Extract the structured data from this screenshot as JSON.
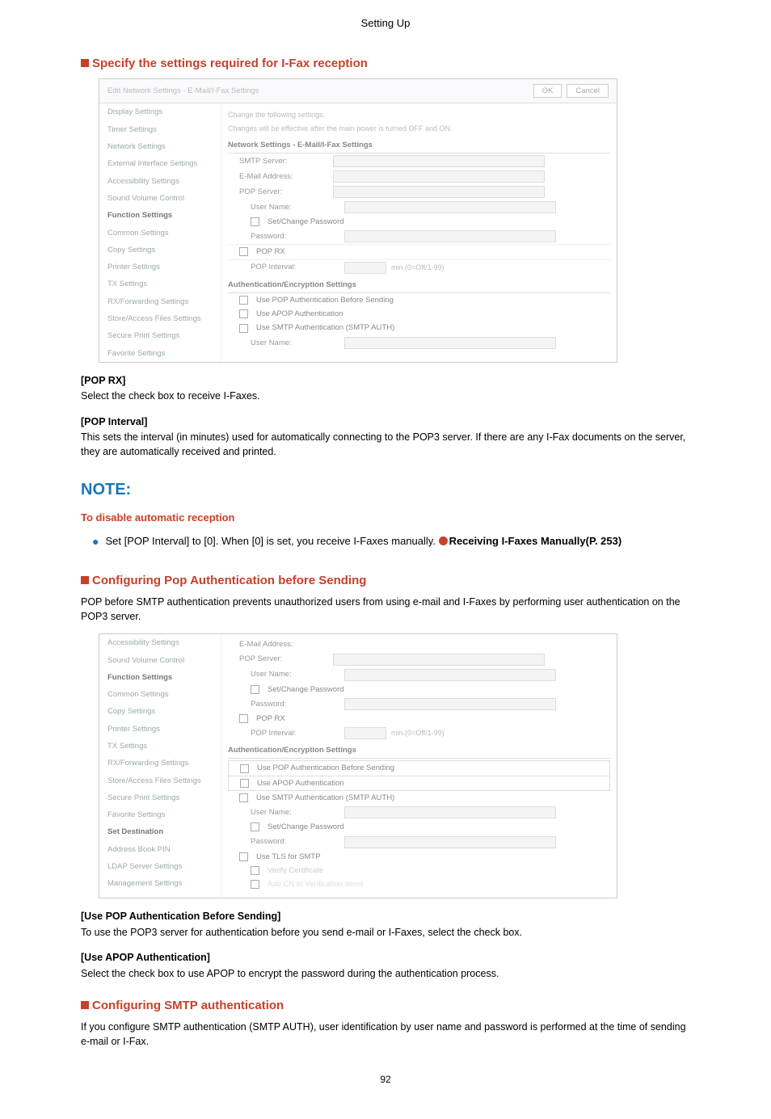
{
  "page_header": "Setting Up",
  "page_number": "92",
  "section1": {
    "title": "Specify the settings required for I-Fax reception",
    "pop_rx_label": "[POP RX]",
    "pop_rx_text": "Select the check box to receive I-Faxes.",
    "pop_interval_label": "[POP Interval]",
    "pop_interval_text": "This sets the interval (in minutes) used for automatically connecting to the POP3 server. If there are any I-Fax documents on the server, they are automatically received and printed."
  },
  "note": {
    "heading": "NOTE:",
    "sub": "To disable automatic reception",
    "bullet_pre": "Set [POP Interval] to [0]. When [0] is set, you receive I-Faxes manually. ",
    "bullet_link": "Receiving I-Faxes Manually(P. 253)"
  },
  "section2": {
    "title": "Configuring Pop Authentication before Sending",
    "intro": "POP before SMTP authentication prevents unauthorized users from using e-mail and I-Faxes by performing user authentication on the POP3 server.",
    "use_pop_label": "[Use POP Authentication Before Sending]",
    "use_pop_text": "To use the POP3 server for authentication before you send e-mail or I-Faxes, select the check box.",
    "use_apop_label": "[Use APOP Authentication]",
    "use_apop_text": "Select the check box to use APOP to encrypt the password during the authentication process."
  },
  "section3": {
    "title": "Configuring SMTP authentication",
    "intro": "If you configure SMTP authentication (SMTP AUTH), user identification by user name and password is performed at the time of sending e-mail or I-Fax."
  },
  "shot1": {
    "breadcrumb": "Edit Network Settings - E-Mail/I-Fax Settings",
    "ok": "OK",
    "cancel": "Cancel",
    "side": {
      "s0": "Display Settings",
      "s1": "Timer Settings",
      "s2": "Network Settings",
      "s3": "External Interface Settings",
      "s4": "Accessibility Settings",
      "s5": "Sound Volume Control",
      "h1": "Function Settings",
      "s6": "Common Settings",
      "s7": "Copy Settings",
      "s8": "Printer Settings",
      "s9": "TX Settings",
      "s10": "RX/Forwarding Settings",
      "s11": "Store/Access Files Settings",
      "s12": "Secure Print Settings",
      "s13": "Favorite Settings"
    },
    "note1": "Change the following settings.",
    "note2": "Changes will be effective after the main power is turned OFF and ON.",
    "sec_a": "Network Settings - E-Mail/I-Fax Settings",
    "f_smtp": "SMTP Server:",
    "f_email": "E-Mail Address:",
    "f_popserver": "POP Server:",
    "f_user": "User Name:",
    "f_setpw": "Set/Change Password",
    "f_pw": "Password:",
    "f_poprx": "POP RX",
    "f_popint": "POP Interval:",
    "f_popint_hint": "min.(0=Off/1-99)",
    "sec_b": "Authentication/Encryption Settings",
    "f_usepop": "Use POP Authentication Before Sending",
    "f_useapop": "Use APOP Authentication",
    "f_usesmtp": "Use SMTP Authentication (SMTP AUTH)",
    "f_user2": "User Name:"
  },
  "shot2": {
    "side": {
      "s0": "Accessibility Settings",
      "s1": "Sound Volume Control",
      "h1": "Function Settings",
      "s2": "Common Settings",
      "s3": "Copy Settings",
      "s4": "Printer Settings",
      "s5": "TX Settings",
      "s6": "RX/Forwarding Settings",
      "s7": "Store/Access Files Settings",
      "s8": "Secure Print Settings",
      "s9": "Favorite Settings",
      "h2": "Set Destination",
      "s10": "Address Book PIN",
      "s11": "LDAP Server Settings",
      "s12": "Management Settings"
    },
    "f_email": "E-Mail Address:",
    "f_popserver": "POP Server:",
    "f_user": "User Name:",
    "f_setpw": "Set/Change Password",
    "f_pw": "Password:",
    "f_poprx": "POP RX",
    "f_popint": "POP Interval:",
    "f_popint_hint": "min.(0=Off/1-99)",
    "sec_b": "Authentication/Encryption Settings",
    "f_usepop": "Use POP Authentication Before Sending",
    "f_useapop": "Use APOP Authentication",
    "f_usesmtp": "Use SMTP Authentication (SMTP AUTH)",
    "f_user2": "User Name:",
    "f_setpw2": "Set/Change Password",
    "f_pw2": "Password:",
    "f_usetls": "Use TLS for SMTP",
    "f_verify": "Verify Certificate",
    "f_addcn": "Add CN to Verification Items"
  }
}
